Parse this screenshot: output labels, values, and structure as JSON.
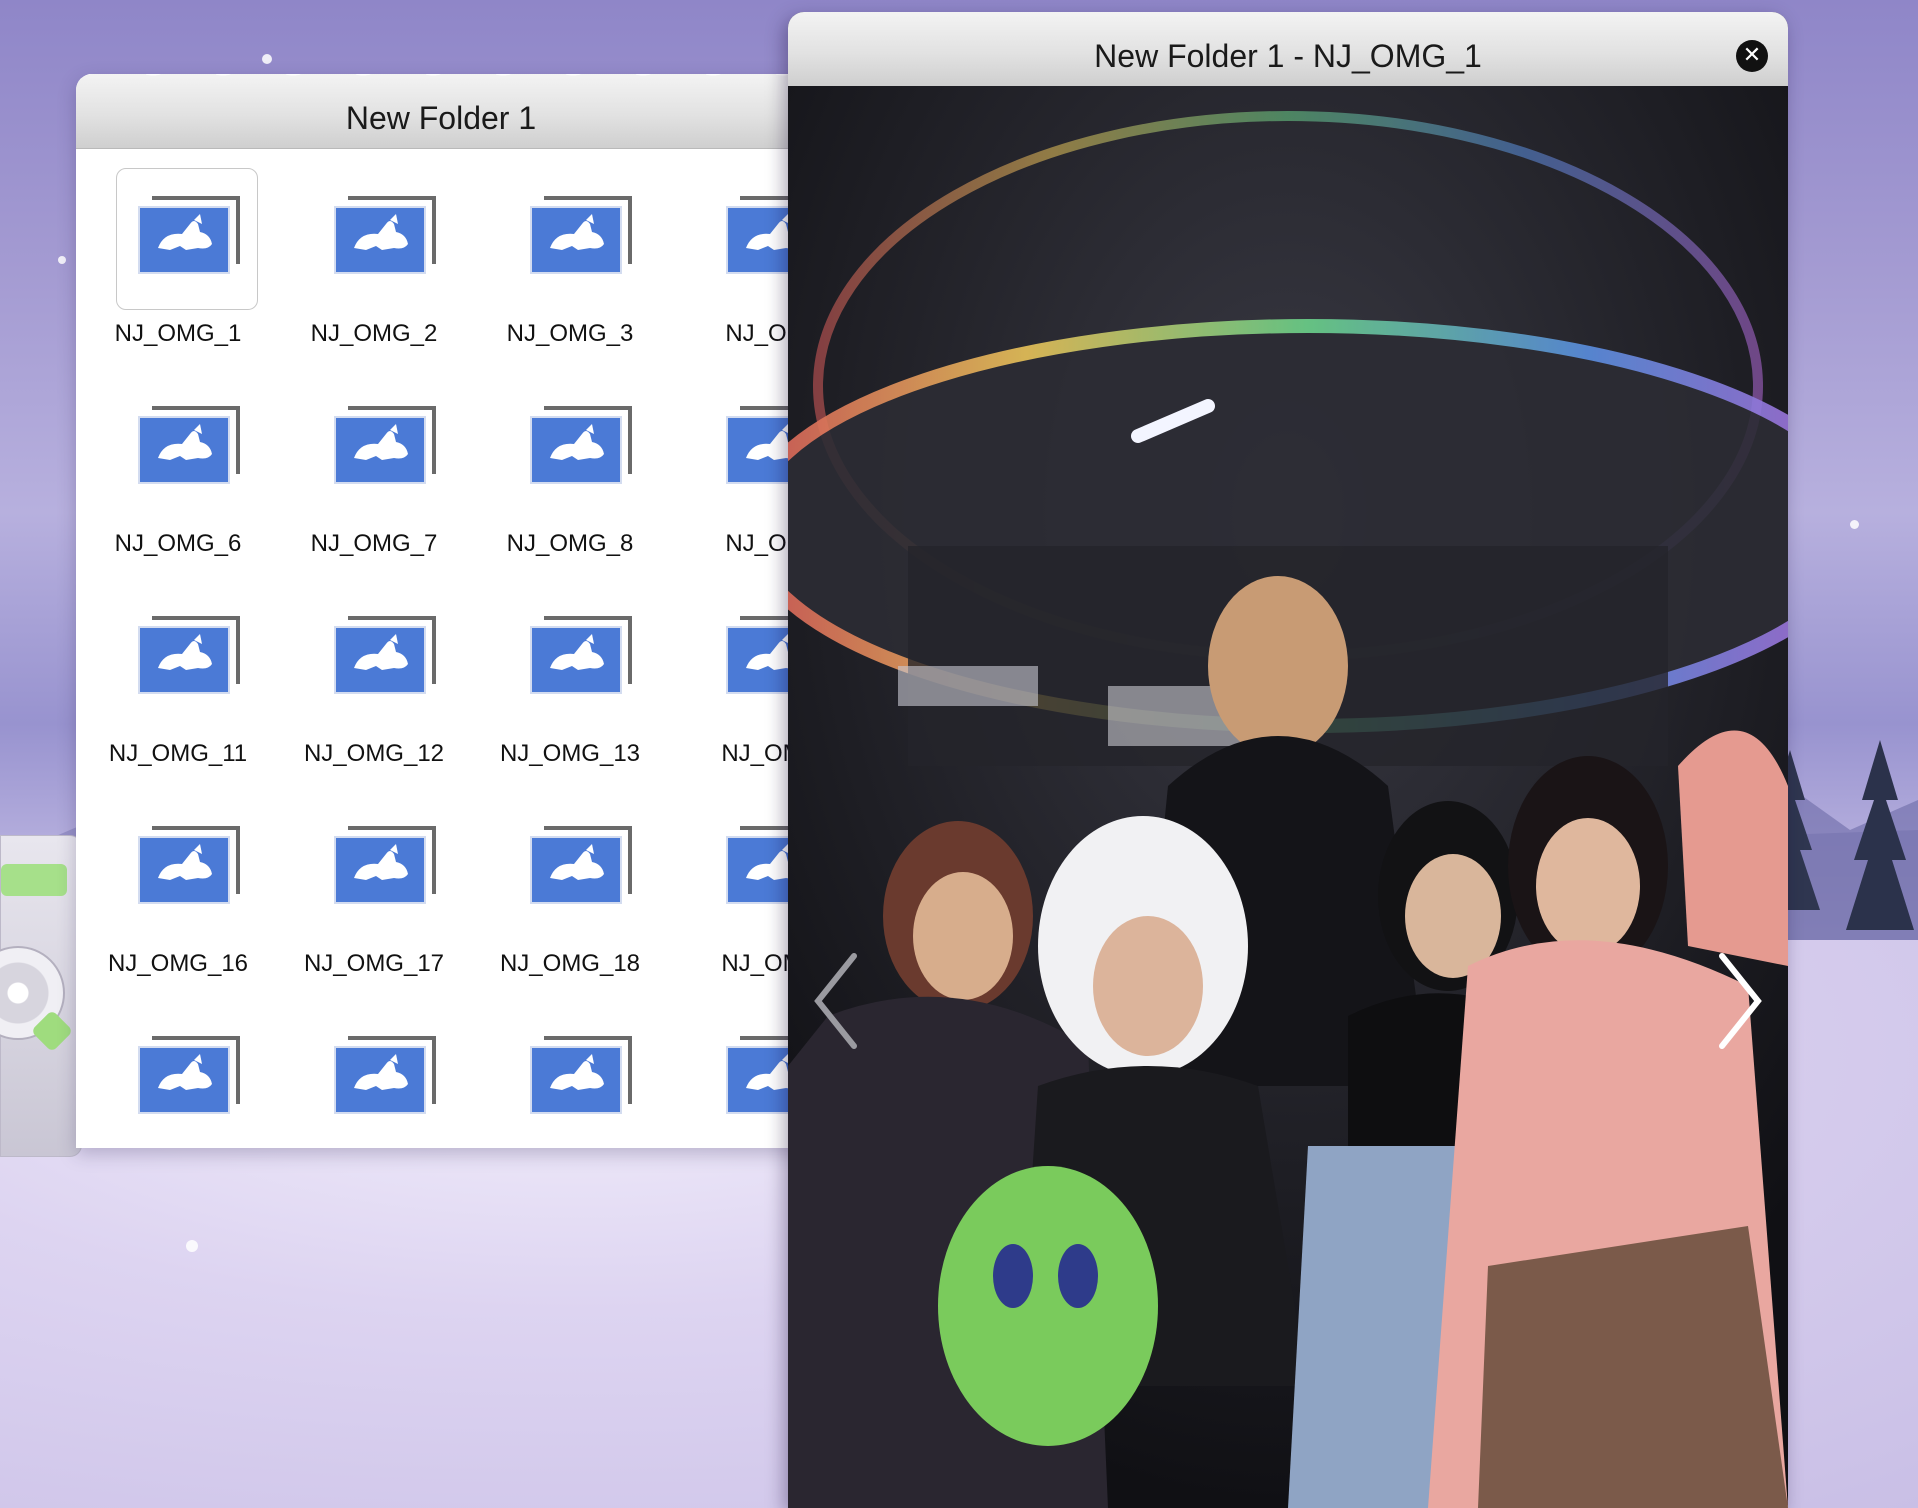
{
  "folder_window": {
    "title": "New Folder 1",
    "files": [
      {
        "label": "NJ_OMG_1",
        "selected": true
      },
      {
        "label": "NJ_OMG_2"
      },
      {
        "label": "NJ_OMG_3"
      },
      {
        "label": "NJ_OM"
      },
      {
        "label": "NJ_OMG_6"
      },
      {
        "label": "NJ_OMG_7"
      },
      {
        "label": "NJ_OMG_8"
      },
      {
        "label": "NJ_OM"
      },
      {
        "label": "NJ_OMG_11"
      },
      {
        "label": "NJ_OMG_12"
      },
      {
        "label": "NJ_OMG_13"
      },
      {
        "label": "NJ_OM("
      },
      {
        "label": "NJ_OMG_16"
      },
      {
        "label": "NJ_OMG_17"
      },
      {
        "label": "NJ_OMG_18"
      },
      {
        "label": "NJ_OM("
      },
      {
        "label": ""
      },
      {
        "label": ""
      },
      {
        "label": ""
      },
      {
        "label": ""
      }
    ],
    "file_icon": "rabbit-image-file-icon",
    "icon_color": "#4b7ad6"
  },
  "viewer_window": {
    "title": "New Folder 1 - NJ_OMG_1",
    "close_icon": "close-icon",
    "prev_icon": "chevron-left-icon",
    "next_icon": "chevron-right-icon"
  },
  "colors": {
    "sky_top": "#8f86c8",
    "snow": "#e5def4",
    "titlebar": "#e2e2e2"
  }
}
